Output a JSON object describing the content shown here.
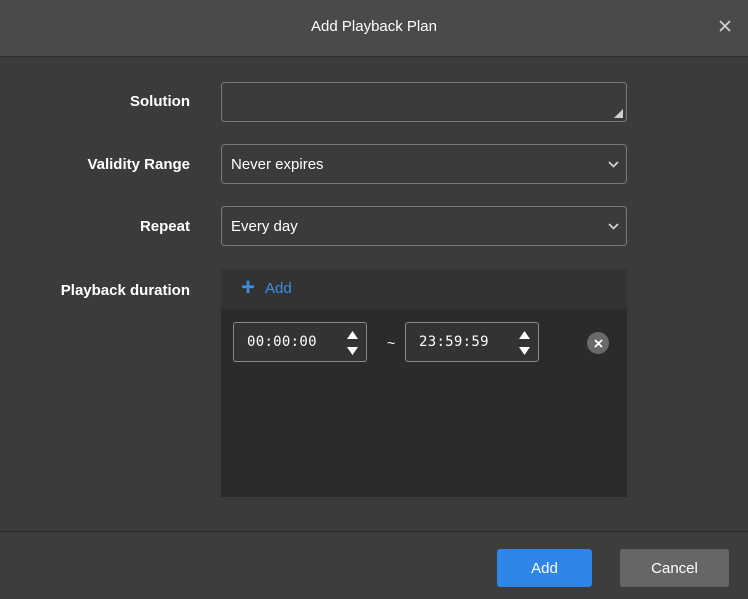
{
  "dialog": {
    "title": "Add Playback Plan",
    "close_icon": "close-icon"
  },
  "form": {
    "solution_label": "Solution",
    "solution_value": "",
    "validity_label": "Validity Range",
    "validity_value": "Never expires",
    "repeat_label": "Repeat",
    "repeat_value": "Every day",
    "duration_label": "Playback duration",
    "add_link_label": "Add",
    "durations": [
      {
        "start": "00:00:00",
        "end": "23:59:59",
        "separator": "~"
      }
    ]
  },
  "footer": {
    "add_label": "Add",
    "cancel_label": "Cancel"
  },
  "colors": {
    "accent": "#2e86e8",
    "link": "#3d8ee6",
    "background": "#3b3b3b",
    "titlebar": "#4a4a4a"
  }
}
